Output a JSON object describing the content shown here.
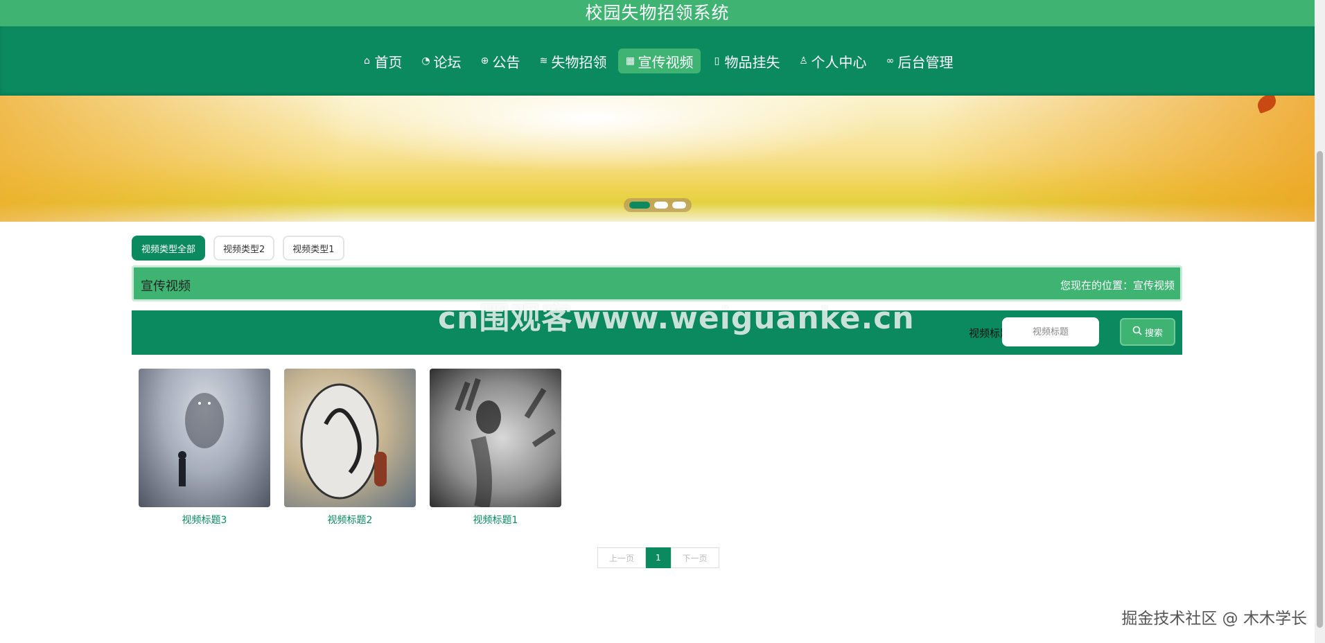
{
  "app": {
    "title": "校园失物招领系统"
  },
  "nav": {
    "items": [
      {
        "label": "首页",
        "icon": "home-icon",
        "glyph": "⌂"
      },
      {
        "label": "论坛",
        "icon": "forum-icon",
        "glyph": "◔"
      },
      {
        "label": "公告",
        "icon": "notice-icon",
        "glyph": "⊕"
      },
      {
        "label": "失物招领",
        "icon": "layers-icon",
        "glyph": "≋"
      },
      {
        "label": "宣传视频",
        "icon": "video-icon",
        "glyph": "▦",
        "active": true
      },
      {
        "label": "物品挂失",
        "icon": "report-icon",
        "glyph": "▯"
      },
      {
        "label": "个人中心",
        "icon": "user-icon",
        "glyph": "♙"
      },
      {
        "label": "后台管理",
        "icon": "link-icon",
        "glyph": "∞"
      }
    ]
  },
  "filters": [
    {
      "label": "视频类型全部",
      "active": true
    },
    {
      "label": "视频类型2"
    },
    {
      "label": "视频类型1"
    }
  ],
  "section": {
    "title": "宣传视频",
    "breadcrumb": "您现在的位置：宣传视频"
  },
  "search": {
    "label": "视频标题",
    "placeholder": "视频标题",
    "button_label": "搜索",
    "watermark": "cn围观客www.weiguanke.cn"
  },
  "videos": [
    {
      "title": "视频标题3"
    },
    {
      "title": "视频标题2"
    },
    {
      "title": "视频标题1"
    }
  ],
  "pagination": {
    "prev": "上一页",
    "current": "1",
    "next": "下一页"
  },
  "footer": {
    "watermark": "掘金技术社区 @ 木木学长"
  },
  "colors": {
    "primary": "#0b8a5f",
    "accent": "#3fb472"
  }
}
